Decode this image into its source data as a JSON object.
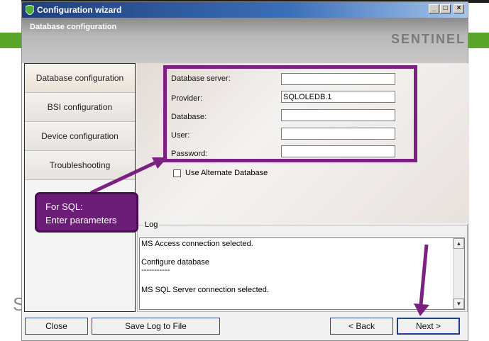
{
  "window": {
    "title": "Configuration wizard",
    "header_title": "Database configuration",
    "brand": "SENTINEL"
  },
  "sidebar": {
    "items": [
      {
        "label": "Database configuration",
        "active": true
      },
      {
        "label": "BSI configuration",
        "active": false
      },
      {
        "label": "Device configuration",
        "active": false
      },
      {
        "label": "Troubleshooting",
        "active": false
      }
    ]
  },
  "form": {
    "database_server": {
      "label": "Database server:",
      "value": ""
    },
    "provider": {
      "label": "Provider:",
      "value": "SQLOLEDB.1"
    },
    "database": {
      "label": "Database:",
      "value": ""
    },
    "user": {
      "label": "User:",
      "value": ""
    },
    "password": {
      "label": "Password:",
      "value": ""
    },
    "alternate_checkbox": {
      "label": "Use Alternate Database",
      "checked": false
    }
  },
  "log": {
    "legend": "Log",
    "lines": [
      "MS Access connection selected.",
      "",
      "Configure database",
      "-----------",
      "",
      "MS SQL Server connection selected."
    ]
  },
  "buttons": {
    "close": "Close",
    "save_log": "Save Log to File",
    "back": "< Back",
    "next": "Next >"
  },
  "annotation": {
    "line1": "For SQL:",
    "line2": "Enter parameters",
    "color": "#7b2281"
  }
}
